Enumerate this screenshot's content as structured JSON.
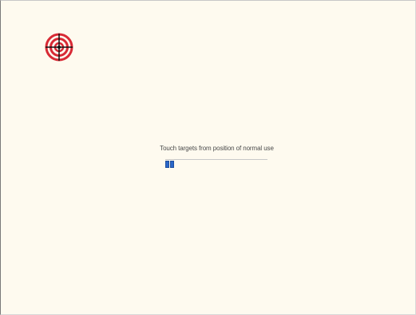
{
  "calibration": {
    "instruction": "Touch targets from position of normal use",
    "target_icon": "crosshair-target-icon",
    "progress": {
      "completed_targets": 2
    }
  },
  "colors": {
    "background": "#fefaef",
    "target_red": "#d82a35",
    "crosshair": "#111111",
    "progress_blue": "#2a66c8"
  }
}
